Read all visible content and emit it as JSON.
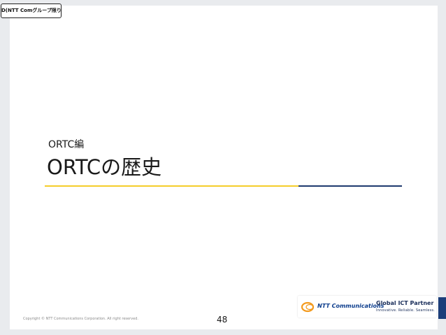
{
  "classification": "D(NTT Comグループ限り)",
  "slide": {
    "subtitle": "ORTC編",
    "title": "ORTCの歴史"
  },
  "footer": {
    "copyright": "Copyright © NTT Communications Corporation. All right reserved.",
    "page_number": "48"
  },
  "logo": {
    "company": "NTT Communications",
    "slogan": "Global ICT Partner",
    "tagline": "Innovative. Reliable. Seamless."
  },
  "colors": {
    "accent_yellow": "#f5cd2a",
    "accent_navy": "#1f3a6e",
    "logo_blue": "#0b3c8c",
    "logo_orange": "#f39a1e"
  }
}
